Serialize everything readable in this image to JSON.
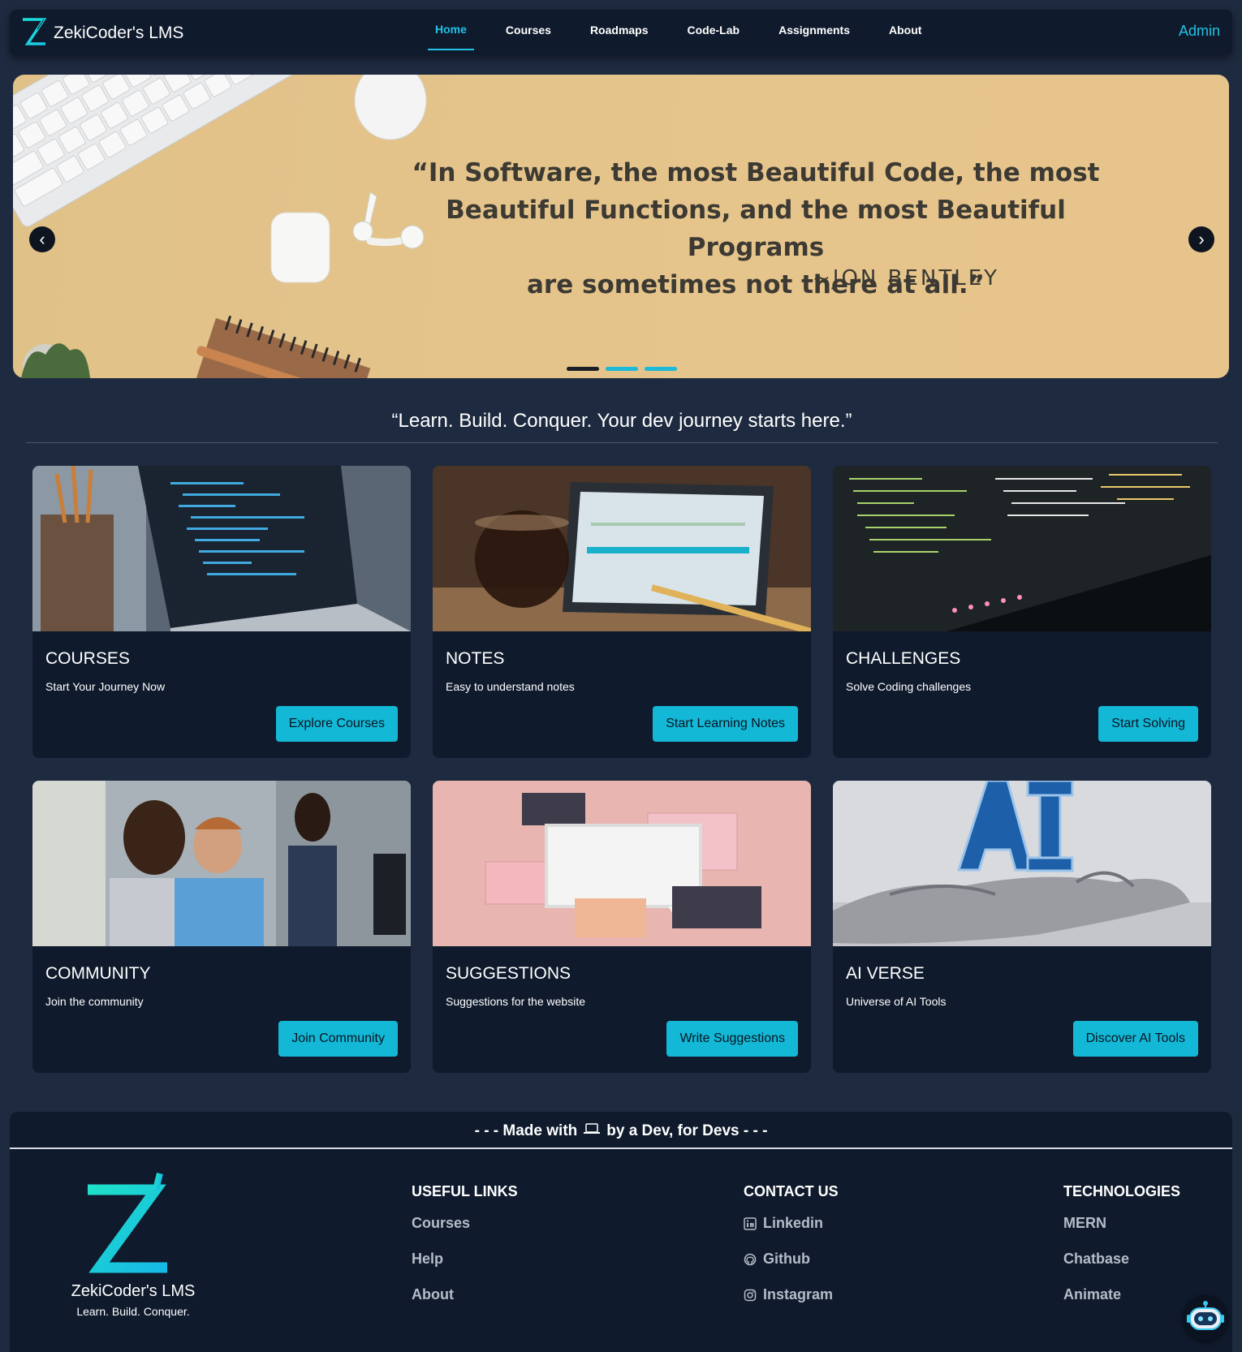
{
  "navbar": {
    "brand": "ZekiCoder's LMS",
    "links": [
      "Home",
      "Courses",
      "Roadmaps",
      "Code-Lab",
      "Assignments",
      "About"
    ],
    "admin": "Admin"
  },
  "carousel": {
    "quote_lines": [
      "“In Software, the most Beautiful Code, the most",
      "Beautiful Functions, and the most Beautiful Programs",
      "are sometimes not there at all.”"
    ],
    "author": "~JON BENTLEY",
    "prev_symbol": "‹",
    "next_symbol": "›",
    "slide_count": 3,
    "active_slide": 1
  },
  "tagline": "“Learn. Build. Conquer. Your dev journey starts here.”",
  "cards": [
    {
      "title": "COURSES",
      "subtitle": "Start Your Journey Now",
      "button": "Explore Courses"
    },
    {
      "title": "NOTES",
      "subtitle": "Easy to understand notes",
      "button": "Start Learning Notes"
    },
    {
      "title": "CHALLENGES",
      "subtitle": "Solve Coding challenges",
      "button": "Start Solving"
    },
    {
      "title": "COMMUNITY",
      "subtitle": "Join the community",
      "button": "Join Community"
    },
    {
      "title": "SUGGESTIONS",
      "subtitle": "Suggestions for the website",
      "button": "Write Suggestions"
    },
    {
      "title": "AI VERSE",
      "subtitle": "Universe of AI Tools",
      "button": "Discover AI Tools"
    }
  ],
  "footer": {
    "made_with_prefix": "- - - Made with",
    "made_with_suffix": "by a Dev, for Devs - - -",
    "brand": "ZekiCoder's LMS",
    "brand_tagline": "Learn. Build. Conquer.",
    "useful_links": {
      "title": "USEFUL LINKS",
      "items": [
        "Courses",
        "Help",
        "About"
      ]
    },
    "contact": {
      "title": "CONTACT US",
      "items": [
        "Linkedin",
        "Github",
        "Instagram"
      ]
    },
    "technologies": {
      "title": "TECHNOLOGIES",
      "items": [
        "MERN",
        "Chatbase",
        "Animate"
      ]
    }
  },
  "colors": {
    "accent": "#22c3e6",
    "button": "#12b8d6",
    "panel": "#0f1a2c",
    "background": "#1e2a3f"
  }
}
